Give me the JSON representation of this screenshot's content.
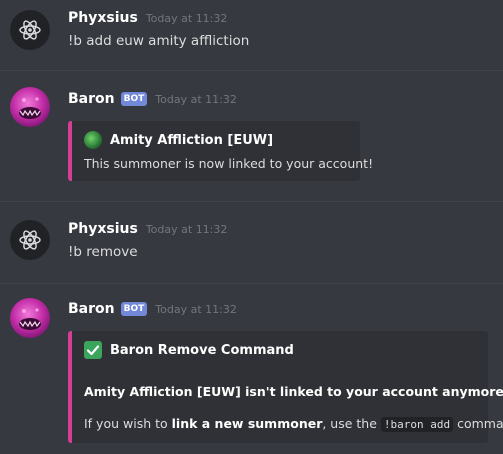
{
  "messages": [
    {
      "author": "Phyxsius",
      "timestamp": "Today at 11:32",
      "content": "!b add euw amity affliction"
    },
    {
      "author": "Baron",
      "bot_tag": "BOT",
      "timestamp": "Today at 11:32",
      "embed": {
        "author": "Amity Affliction [EUW]",
        "description": "This summoner is now linked to your account!"
      }
    },
    {
      "author": "Phyxsius",
      "timestamp": "Today at 11:32",
      "content": "!b remove"
    },
    {
      "author": "Baron",
      "bot_tag": "BOT",
      "timestamp": "Today at 11:32",
      "embed": {
        "author": "Baron Remove Command",
        "title_line": "Amity Affliction [EUW] isn't linked to your account anymore!",
        "help_prefix": "If you wish to ",
        "help_bold": "link a new summoner",
        "help_middle": ", use the ",
        "help_code": "!baron add",
        "help_suffix": " command!"
      }
    }
  ],
  "colors": {
    "background": "#36393f",
    "embed_background": "#2f3136",
    "embed_accent": "#d43f95",
    "bot_tag": "#7289da",
    "timestamp": "#72767d",
    "text": "#dcddde",
    "check": "#3ba55d"
  },
  "icons": {
    "phyxsius_avatar": "atom-icon",
    "baron_avatar": "baron-nashor-avatar",
    "summoner_icon": "summoner-profile-icon",
    "success_icon": "check-mark-icon"
  }
}
